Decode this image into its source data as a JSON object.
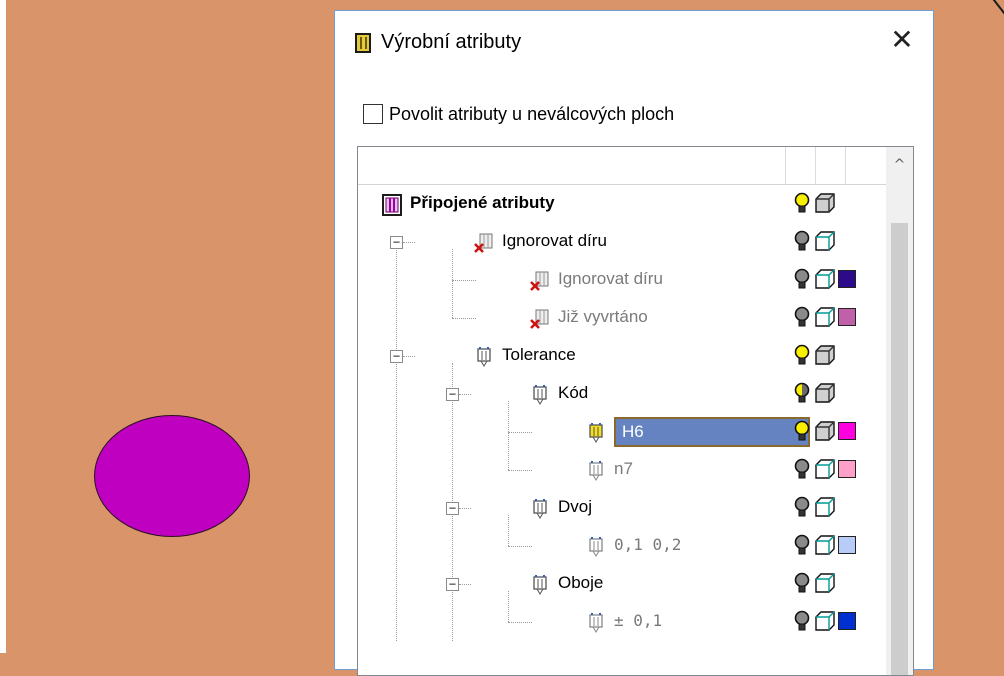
{
  "dialog": {
    "title": "Výrobní atributy",
    "close_glyph": "✕",
    "checkbox_label": "Povolit atributy u neválcových ploch",
    "checkbox_checked": false
  },
  "scrollbar": {
    "up_glyph": "^"
  },
  "colors": {
    "background": "#d9946a",
    "sphere": "#c000c0",
    "selection": "#6483c0"
  },
  "tree": {
    "items": [
      {
        "label": "Připojené atributy",
        "style": "bold",
        "icon": "attributes-root-icon",
        "bulb": "yellow",
        "cube": "gray",
        "swatch": null
      },
      {
        "label": "Ignorovat díru",
        "style": "normal",
        "icon": "ignore-hole-icon",
        "bulb": "dark",
        "cube": "cyan",
        "swatch": null
      },
      {
        "label": "Ignorovat díru",
        "style": "gray",
        "icon": "ignore-hole-icon",
        "bulb": "dark",
        "cube": "cyan",
        "swatch": "#2d0a8a"
      },
      {
        "label": "Již vyvrtáno",
        "style": "gray",
        "icon": "ignore-hole-icon",
        "bulb": "dark",
        "cube": "cyan",
        "swatch": "#c060a8"
      },
      {
        "label": "Tolerance",
        "style": "normal",
        "icon": "tolerance-icon",
        "bulb": "yellow",
        "cube": "gray",
        "swatch": null
      },
      {
        "label": "Kód",
        "style": "normal",
        "icon": "tolerance-icon",
        "bulb": "mixed",
        "cube": "gray",
        "swatch": null
      },
      {
        "label": "H6",
        "style": "selected",
        "icon": "tolerance-icon",
        "bulb": "yellow",
        "cube": "gray",
        "swatch": "#ff00e0"
      },
      {
        "label": "n7",
        "style": "gray",
        "icon": "tolerance-icon",
        "bulb": "dark",
        "cube": "cyan",
        "swatch": "#ffa0c8"
      },
      {
        "label": "Dvoj",
        "style": "normal",
        "icon": "tolerance-icon",
        "bulb": "dark",
        "cube": "cyan",
        "swatch": null
      },
      {
        "label": "0,1     0,2",
        "style": "mono",
        "icon": "tolerance-icon",
        "bulb": "dark",
        "cube": "cyan",
        "swatch": "#b8ccf8"
      },
      {
        "label": "Oboje",
        "style": "normal",
        "icon": "tolerance-icon",
        "bulb": "dark",
        "cube": "cyan",
        "swatch": null
      },
      {
        "label": "± 0,1",
        "style": "mono",
        "icon": "tolerance-icon",
        "bulb": "dark",
        "cube": "cyan",
        "swatch": "#0030d0"
      }
    ]
  }
}
